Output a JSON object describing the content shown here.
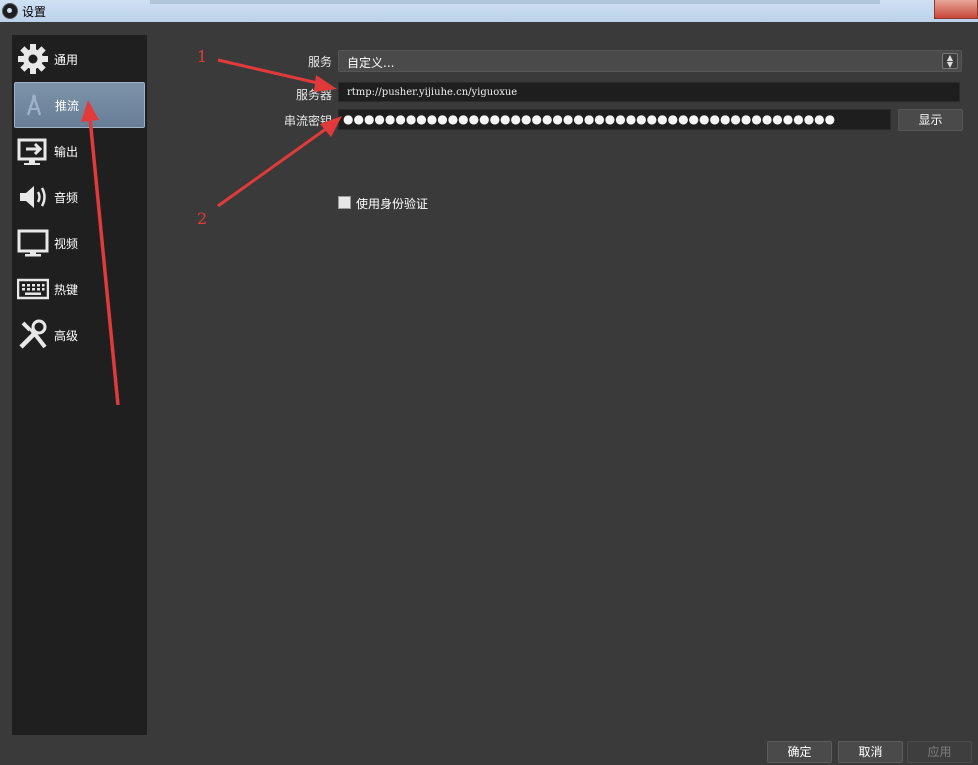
{
  "window": {
    "title": "设置"
  },
  "sidebar": {
    "items": [
      {
        "label": "通用",
        "icon": "gear-icon"
      },
      {
        "label": "推流",
        "icon": "stream-icon"
      },
      {
        "label": "输出",
        "icon": "output-icon"
      },
      {
        "label": "音频",
        "icon": "speaker-icon"
      },
      {
        "label": "视频",
        "icon": "monitor-icon"
      },
      {
        "label": "热键",
        "icon": "keyboard-icon"
      },
      {
        "label": "高级",
        "icon": "tools-icon"
      }
    ],
    "active": "推流"
  },
  "form": {
    "service_label": "服务",
    "service_value": "自定义...",
    "server_label": "服务器",
    "server_value": "rtmp://pusher.yijiuhe.cn/yiguoxue",
    "key_label": "串流密钥",
    "key_masked": "●●●●●●●●●●●●●●●●●●●●●●●●●●●●●●●●●●●●●●●●●●●●●●●",
    "show_label": "显示",
    "auth_label": "使用身份验证"
  },
  "buttons": {
    "ok": "确定",
    "cancel": "取消",
    "apply": "应用"
  },
  "annotations": {
    "one": "1",
    "two": "2",
    "color": "#e03a3a"
  },
  "colors": {
    "background": "#3a3a3a",
    "sidebar": "#1f1f1f",
    "active_item": "#6f86a0"
  }
}
